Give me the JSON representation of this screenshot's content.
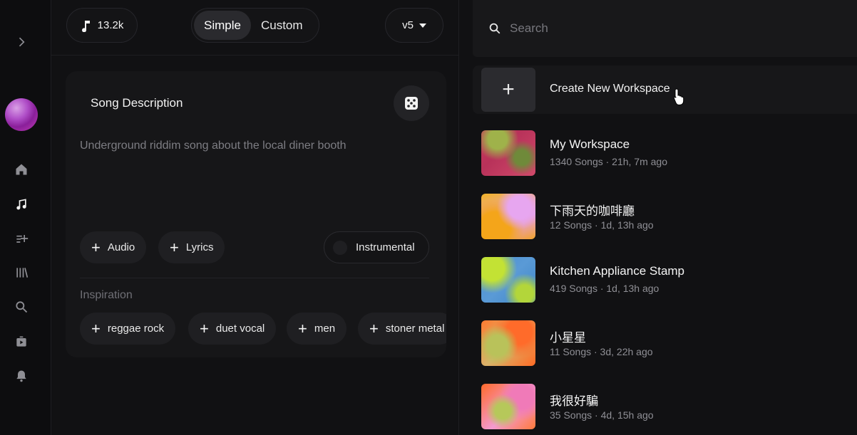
{
  "topbar": {
    "credits": "13.2k",
    "mode_options": [
      "Simple",
      "Custom"
    ],
    "active_mode": "Simple",
    "version": "v5"
  },
  "sidebar": {
    "icons": [
      "chevron-right-icon",
      "home-icon",
      "create-music-icon",
      "playlist-add-icon",
      "library-icon",
      "search-icon",
      "video-icon",
      "bell-icon"
    ]
  },
  "song_card": {
    "title": "Song Description",
    "description": "Underground riddim song about the local diner booth",
    "add_audio": "Audio",
    "add_lyrics": "Lyrics",
    "instrumental": "Instrumental",
    "inspiration_label": "Inspiration",
    "tags": [
      "reggae rock",
      "duet vocal",
      "men",
      "stoner metal"
    ]
  },
  "search": {
    "placeholder": "Search"
  },
  "workspaces": {
    "create_label": "Create New Workspace",
    "items": [
      {
        "name": "My Workspace",
        "meta": "1340 Songs · 21h, 7m ago"
      },
      {
        "name": "下雨天的咖啡廳",
        "meta": "12 Songs · 1d, 13h ago"
      },
      {
        "name": "Kitchen Appliance Stamp",
        "meta": "419 Songs · 1d, 13h ago"
      },
      {
        "name": "小星星",
        "meta": "11 Songs · 3d, 22h ago"
      },
      {
        "name": "我很好騙",
        "meta": "35 Songs · 4d, 15h ago"
      }
    ]
  },
  "colors": {
    "background": "#111113",
    "panel": "#161618",
    "chip": "#1f1f22",
    "muted_text": "#7d7d83"
  }
}
